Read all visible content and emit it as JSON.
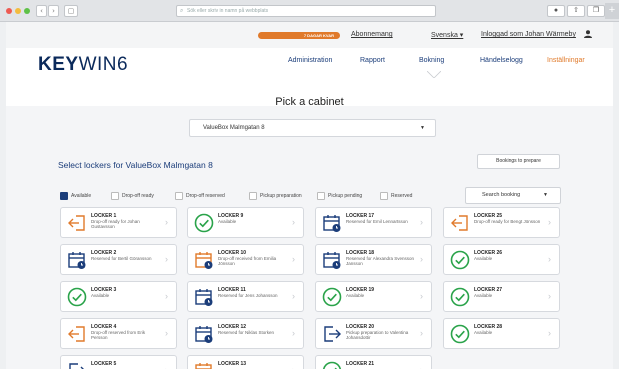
{
  "browser": {
    "url_placeholder": "Sök eller skriv in namn på webbplats",
    "nav_back": "‹",
    "nav_forward": "›",
    "sidebar_toggle": "▢",
    "plus": "+"
  },
  "topbar": {
    "trial": "7 DAGAR KVAR",
    "subscription": "Abonnemang",
    "language": "Svenska ▾",
    "login": "Inloggad som Johan Wärmeby"
  },
  "logo": {
    "bold": "KEY",
    "light": "WIN6"
  },
  "menu": [
    {
      "label": "Administration"
    },
    {
      "label": "Rapport"
    },
    {
      "label": "Bokning"
    },
    {
      "label": "Händelselogg"
    },
    {
      "label": "Inställningar"
    }
  ],
  "main": {
    "title": "Pick a cabinet",
    "cabinet_select": "ValueBox Malmgatan 8",
    "subtitle": "Select lockers for ValueBox Malmgatan 8",
    "bookings_button": "Bookings to prepare",
    "search_booking": "Search booking"
  },
  "filters": [
    {
      "label": "Available",
      "checked": true
    },
    {
      "label": "Drop-off ready",
      "checked": false
    },
    {
      "label": "Drop-off reserved",
      "checked": false
    },
    {
      "label": "Pickup preparation",
      "checked": false
    },
    {
      "label": "Pickup pending",
      "checked": false
    },
    {
      "label": "Reserved",
      "checked": false
    }
  ],
  "colors": {
    "navy": "#1b3d7a",
    "orange": "#e07a2b",
    "green": "#2aa34a"
  },
  "lockers": [
    {
      "name": "LOCKER 1",
      "status": "Drop-off ready for Johan Gustavsson",
      "icon": "dropoff-icon"
    },
    {
      "name": "LOCKER 2",
      "status": "Reserved for Bertil Göransson",
      "icon": "calendar-icon"
    },
    {
      "name": "LOCKER 3",
      "status": "Available",
      "icon": "check-icon"
    },
    {
      "name": "LOCKER 4",
      "status": "Drop-off reserved from Erik Persson",
      "icon": "dropoff-icon"
    },
    {
      "name": "LOCKER 5",
      "status": "",
      "icon": "pickup-icon"
    },
    {
      "name": "LOCKER 9",
      "status": "Available",
      "icon": "check-icon"
    },
    {
      "name": "LOCKER 10",
      "status": "Drop-off received from Emilia Jönsson",
      "icon": "calendar-orange-icon"
    },
    {
      "name": "LOCKER 11",
      "status": "Reserved for Jens Johansson",
      "icon": "calendar-icon"
    },
    {
      "name": "LOCKER 12",
      "status": "Reserved for Niklas Storken",
      "icon": "calendar-icon"
    },
    {
      "name": "LOCKER 13",
      "status": "",
      "icon": "calendar-orange-icon"
    },
    {
      "name": "LOCKER 17",
      "status": "Reserved for Emil Lennartsson",
      "icon": "calendar-icon"
    },
    {
      "name": "LOCKER 18",
      "status": "Reserved for Alexandra Svensson Jansson",
      "icon": "calendar-icon"
    },
    {
      "name": "LOCKER 19",
      "status": "Available",
      "icon": "check-icon"
    },
    {
      "name": "LOCKER 20",
      "status": "Pickup preparation to Valentina Johansdottir",
      "icon": "pickup-icon"
    },
    {
      "name": "LOCKER 21",
      "status": "",
      "icon": "check-icon"
    },
    {
      "name": "LOCKER 25",
      "status": "Drop-off ready for Bengt Jönsson",
      "icon": "dropoff-icon"
    },
    {
      "name": "LOCKER 26",
      "status": "Available",
      "icon": "check-icon"
    },
    {
      "name": "LOCKER 27",
      "status": "Available",
      "icon": "check-icon"
    },
    {
      "name": "LOCKER 28",
      "status": "Available",
      "icon": "check-icon"
    }
  ]
}
